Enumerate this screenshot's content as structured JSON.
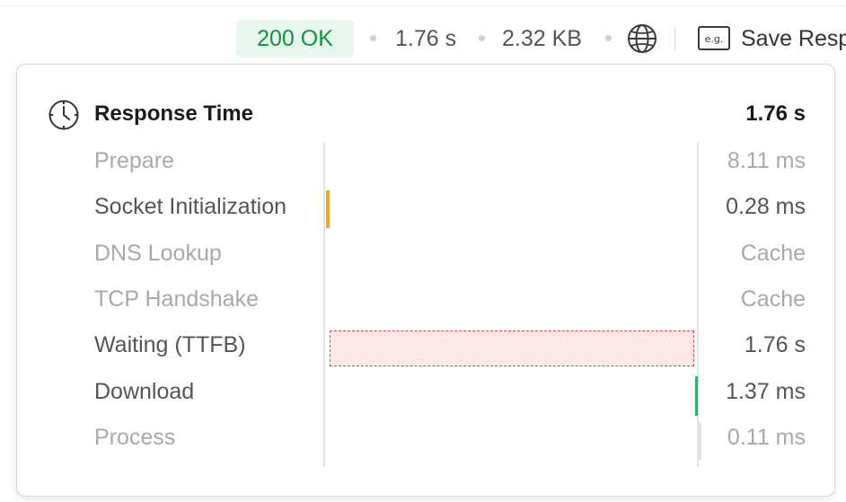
{
  "status": {
    "code_label": "200 OK",
    "time": "1.76 s",
    "size": "2.32 KB",
    "save_label": "Save Resp",
    "eg_label": "e.g."
  },
  "icons": {
    "globe": "globe-icon",
    "example": "example-icon",
    "clock": "clock-icon"
  },
  "colors": {
    "status_ok": "#12933f",
    "socket_bar": "#f5a623",
    "ttfb_bar_fill": "#fde8e8",
    "ttfb_bar_border": "#e04343",
    "download_bar": "#2bb26b"
  },
  "timing": {
    "title": "Response Time",
    "total": "1.76 s",
    "phases": [
      {
        "label": "Prepare",
        "value": "8.11 ms",
        "muted": true
      },
      {
        "label": "Socket Initialization",
        "value": "0.28 ms",
        "muted": false
      },
      {
        "label": "DNS Lookup",
        "value": "Cache",
        "muted": true
      },
      {
        "label": "TCP Handshake",
        "value": "Cache",
        "muted": true
      },
      {
        "label": "Waiting (TTFB)",
        "value": "1.76 s",
        "muted": false
      },
      {
        "label": "Download",
        "value": "1.37 ms",
        "muted": false
      },
      {
        "label": "Process",
        "value": "0.11 ms",
        "muted": true
      }
    ]
  }
}
